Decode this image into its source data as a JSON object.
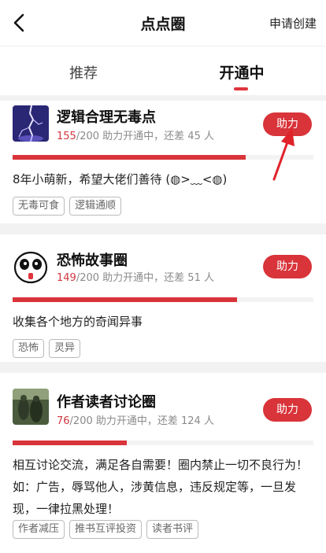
{
  "header": {
    "title": "点点圈",
    "create_label": "申请创建"
  },
  "tabs": [
    {
      "label": "推荐",
      "active": false
    },
    {
      "label": "开通中",
      "active": true
    }
  ],
  "progress_suffix": "/200 助力开通中，还差",
  "people_unit": "人",
  "circles": [
    {
      "name": "逻辑合理无毒点",
      "current": "155",
      "remaining": "45",
      "progress": 0.775,
      "help_label": "助力",
      "description": "8年小萌新，希望大佬们善待 (◍>﹏<◍)",
      "tags": [
        "无毒可食",
        "逻辑通顺"
      ]
    },
    {
      "name": "恐怖故事圈",
      "current": "149",
      "remaining": "51",
      "progress": 0.745,
      "help_label": "助力",
      "description": "收集各个地方的奇闻异事",
      "tags": [
        "恐怖",
        "灵异"
      ]
    },
    {
      "name": "作者读者讨论圈",
      "current": "76",
      "remaining": "124",
      "progress": 0.38,
      "help_label": "助力",
      "description": "相互讨论交流，满足各自需要！圈内禁止一切不良行为！如：广告，辱骂他人，涉黄信息，违反规定等，一旦发现，一律拉黑处理！",
      "tags": [
        "作者减压",
        "推书互评投资",
        "读者书评"
      ]
    }
  ],
  "colors": {
    "accent": "#d8343a"
  }
}
